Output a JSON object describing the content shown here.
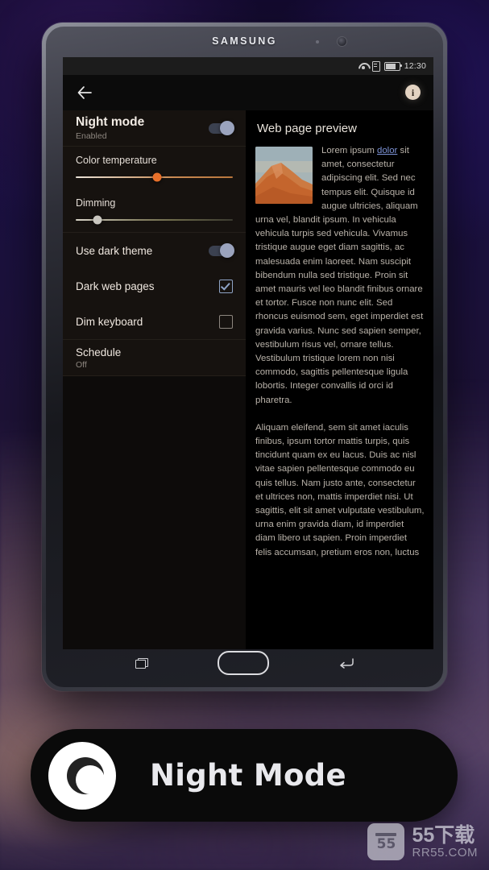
{
  "device": {
    "brand": "SAMSUNG",
    "status_bar": {
      "time": "12:30",
      "icons": [
        "wifi-icon",
        "sim-card-icon",
        "battery-icon"
      ]
    },
    "nav_bar": {
      "back": "back-nav-button",
      "home": "home-nav-button",
      "recents": "recents-nav-button"
    },
    "hardware_keys": {
      "recents": "recents-hardware-key",
      "home": "home-hardware-key",
      "back": "back-hardware-key"
    }
  },
  "app_bar": {
    "back_icon": "back-arrow-icon",
    "info_label": "i"
  },
  "settings": {
    "night_mode": {
      "title": "Night mode",
      "subtitle": "Enabled",
      "enabled": true
    },
    "color_temperature": {
      "label": "Color temperature",
      "value_percent": 52
    },
    "dimming": {
      "label": "Dimming",
      "value_percent": 14
    },
    "use_dark_theme": {
      "label": "Use dark theme",
      "enabled": true
    },
    "dark_web_pages": {
      "label": "Dark web pages",
      "checked": true
    },
    "dim_keyboard": {
      "label": "Dim keyboard",
      "checked": false
    },
    "schedule": {
      "title": "Schedule",
      "subtitle": "Off"
    }
  },
  "preview": {
    "title": "Web page preview",
    "thumbnail_alt": "desert-dune-thumbnail",
    "paragraph1_lead": "Lorem ipsum ",
    "paragraph1_link": "dolor",
    "paragraph1_rest": " sit amet, consectetur adipiscing elit. Sed nec tempus elit. Quisque id augue ultricies, aliquam urna vel, blandit ipsum. In vehicula vehicula turpis sed vehicula. Vivamus tristique augue eget diam sagittis, ac malesuada enim laoreet. Nam suscipit bibendum nulla sed tristique. Proin sit amet mauris vel leo blandit finibus ornare et tortor. Fusce non nunc elit. Sed rhoncus euismod sem, eget imperdiet est gravida varius. Nunc sed sapien semper, vestibulum risus vel, ornare tellus. Vestibulum tristique lorem non nisi commodo, sagittis pellentesque ligula lobortis. Integer convallis id orci id pharetra.",
    "paragraph2": "Aliquam eleifend, sem sit amet iaculis finibus, ipsum tortor mattis turpis, quis tincidunt quam ex eu lacus. Duis ac nisl vitae sapien pellentesque commodo eu quis tellus. Nam justo ante, consectetur et ultrices non, mattis imperdiet nisi. Ut sagittis, elit sit amet vulputate vestibulum, urna enim gravida diam, id imperdiet diam libero ut sapien. Proin imperdiet felis accumsan, pretium eros non, luctus"
  },
  "banner": {
    "title": "Night Mode",
    "logo": "crescent-moon-icon"
  },
  "watermark": {
    "mark": "55",
    "title": "55下载",
    "site": "RR55.COM"
  },
  "colors": {
    "accent_orange": "#e8702a",
    "toggle_on": "#9aa3bd",
    "link_blue": "#7d93d6",
    "info_badge": "#e3d3c2"
  }
}
